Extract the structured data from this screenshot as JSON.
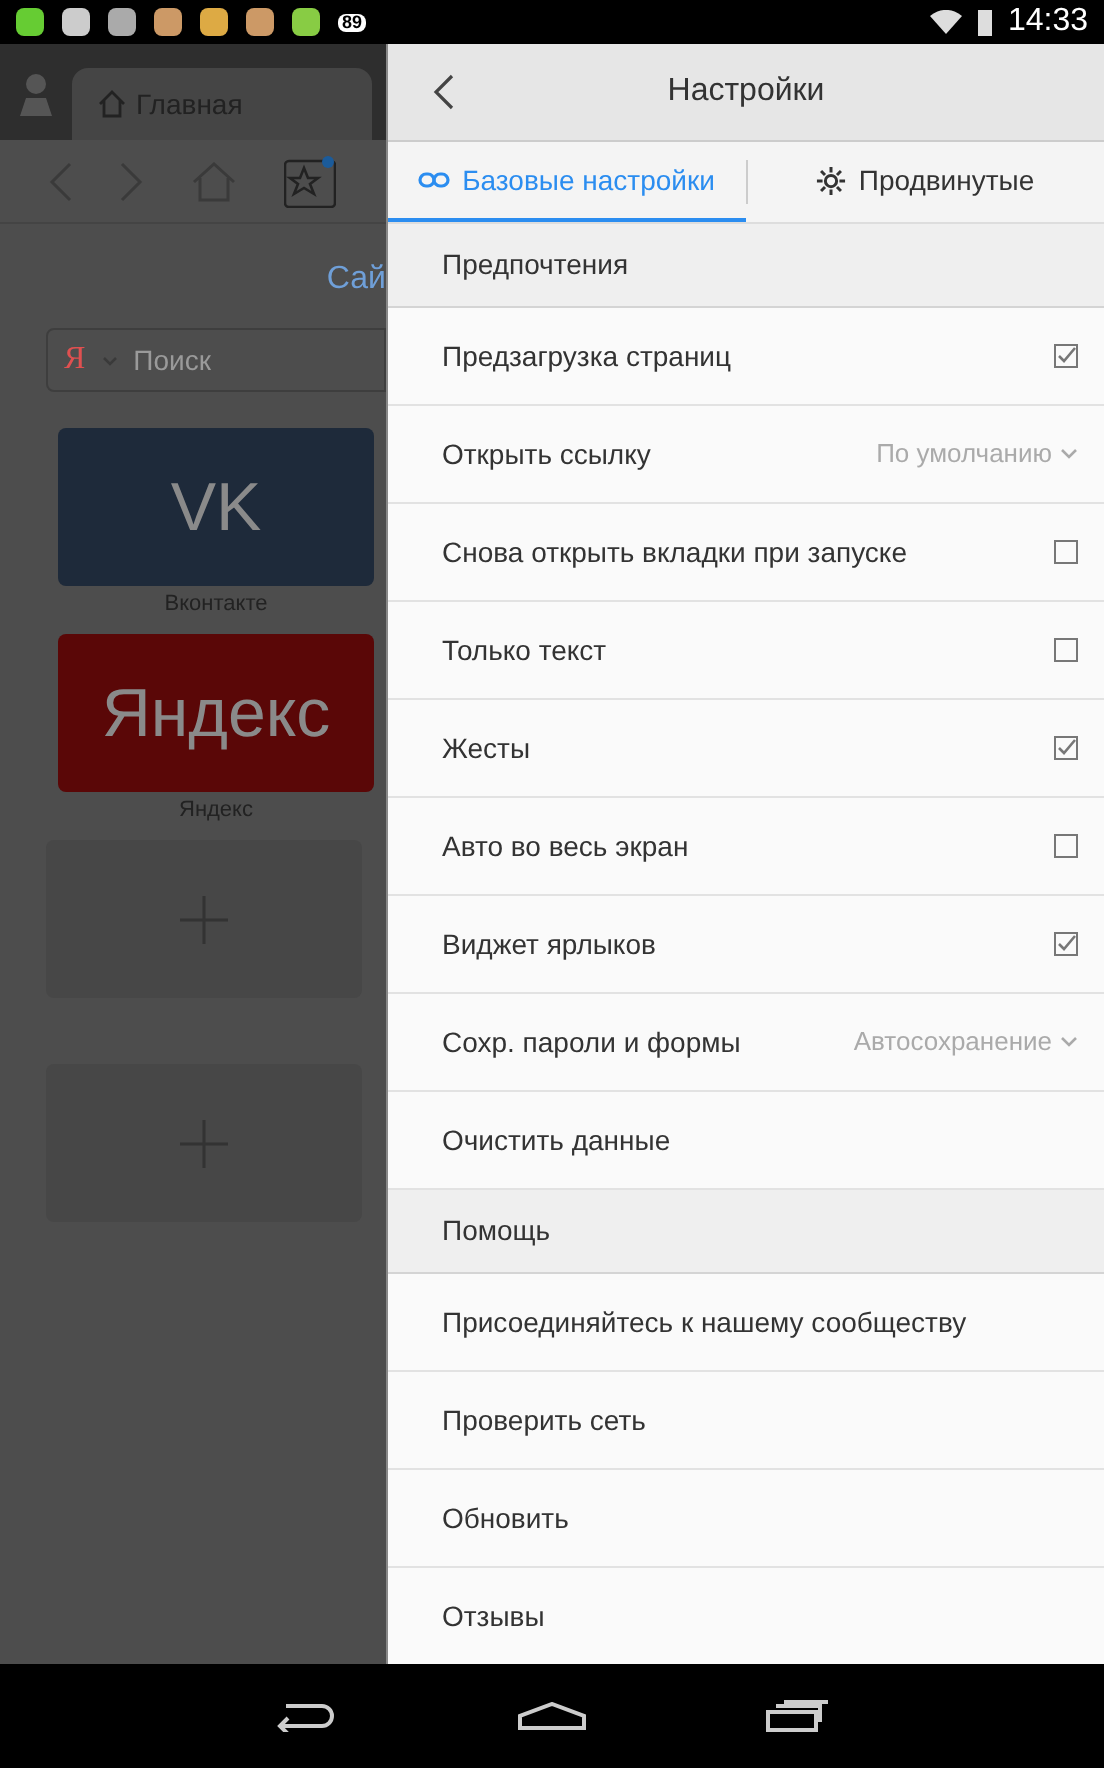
{
  "status_bar": {
    "badge": "89",
    "time": "14:33"
  },
  "browser": {
    "tab": "Главная",
    "site_link": "Сай",
    "search": {
      "engine": "Я",
      "placeholder": "Поиск"
    },
    "tiles": [
      {
        "kind": "site",
        "logo": "VK",
        "label": "Вконтакте",
        "color": "#1e2a3a"
      },
      {
        "kind": "site",
        "logo": "Яндекс",
        "label": "Яндекс",
        "color": "#5a0707"
      },
      {
        "kind": "add"
      },
      {
        "kind": "add"
      }
    ]
  },
  "settings": {
    "title": "Настройки",
    "tabs": [
      {
        "label": "Базовые настройки",
        "selected": true,
        "kind": "link"
      },
      {
        "label": "Продвинутые",
        "selected": false,
        "kind": "gear"
      }
    ],
    "rows": [
      {
        "kind": "section",
        "label": "Предпочтения"
      },
      {
        "kind": "checkbox",
        "label": "Предзагрузка страниц",
        "checked": true
      },
      {
        "kind": "select",
        "label": "Открыть ссылку",
        "value": "По умолчанию"
      },
      {
        "kind": "checkbox",
        "label": "Снова открыть вкладки при запуске",
        "checked": false
      },
      {
        "kind": "checkbox",
        "label": "Только текст",
        "checked": false
      },
      {
        "kind": "checkbox",
        "label": "Жесты",
        "checked": true
      },
      {
        "kind": "checkbox",
        "label": "Авто во весь экран",
        "checked": false
      },
      {
        "kind": "checkbox",
        "label": "Виджет ярлыков",
        "checked": true
      },
      {
        "kind": "select",
        "label": "Сохр. пароли и формы",
        "value": "Автосохранение"
      },
      {
        "kind": "action",
        "label": "Очистить данные"
      },
      {
        "kind": "section",
        "label": "Помощь"
      },
      {
        "kind": "action",
        "label": "Присоединяйтесь к нашему сообществу"
      },
      {
        "kind": "action",
        "label": "Проверить сеть"
      },
      {
        "kind": "action",
        "label": "Обновить"
      },
      {
        "kind": "action",
        "label": "Отзывы"
      }
    ]
  }
}
